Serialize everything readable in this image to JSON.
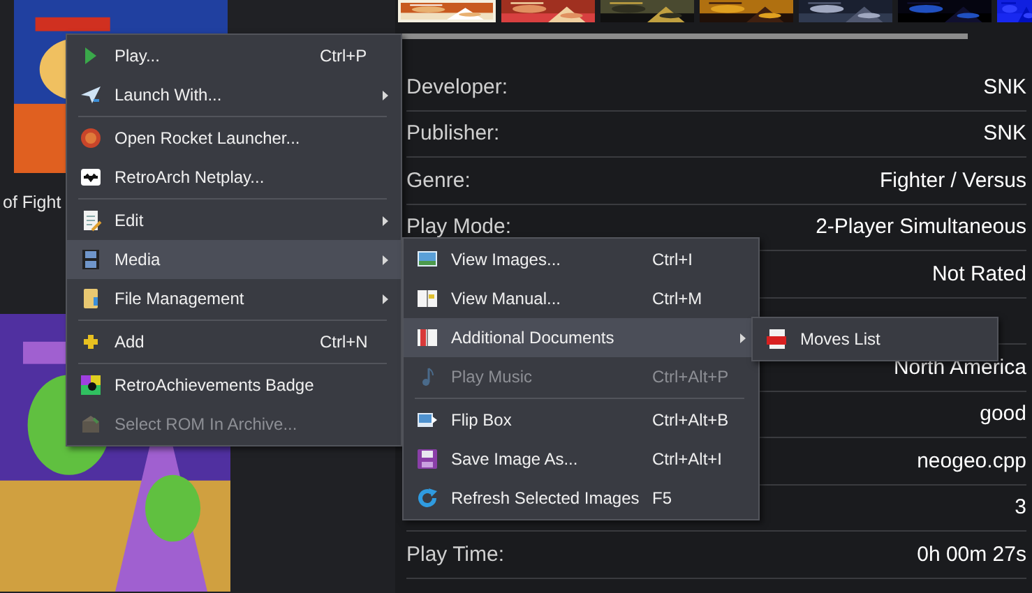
{
  "library": {
    "caption": "of Fight"
  },
  "details": {
    "rows": [
      {
        "label": "Developer:",
        "value": "SNK"
      },
      {
        "label": "Publisher:",
        "value": "SNK"
      },
      {
        "label": "Genre:",
        "value": "Fighter / Versus"
      },
      {
        "label": "Play Mode:",
        "value": "2-Player Simultaneous"
      },
      {
        "value": "Not Rated"
      },
      {},
      {
        "value": "North America"
      },
      {
        "value": "good"
      },
      {
        "value": "neogeo.cpp"
      },
      {
        "value": "3"
      },
      {
        "label": "Play Time:",
        "value": "0h 00m 27s"
      }
    ]
  },
  "context_menu": {
    "items": [
      {
        "kind": "item",
        "label": "Play...",
        "shortcut": "Ctrl+P",
        "has_submenu": false,
        "disabled": false,
        "selected": false
      },
      {
        "kind": "item",
        "label": "Launch With...",
        "has_submenu": true,
        "disabled": false,
        "selected": false
      },
      {
        "kind": "separator"
      },
      {
        "kind": "item",
        "label": "Open Rocket Launcher...",
        "has_submenu": false,
        "disabled": false,
        "selected": false
      },
      {
        "kind": "item",
        "label": "RetroArch Netplay...",
        "has_submenu": false,
        "disabled": false,
        "selected": false
      },
      {
        "kind": "separator"
      },
      {
        "kind": "item",
        "label": "Edit",
        "has_submenu": true,
        "disabled": false,
        "selected": false
      },
      {
        "kind": "item",
        "label": "Media",
        "has_submenu": true,
        "disabled": false,
        "selected": true
      },
      {
        "kind": "item",
        "label": "File Management",
        "has_submenu": true,
        "disabled": false,
        "selected": false
      },
      {
        "kind": "separator"
      },
      {
        "kind": "item",
        "label": "Add",
        "shortcut": "Ctrl+N",
        "has_submenu": false,
        "disabled": false,
        "selected": false
      },
      {
        "kind": "separator"
      },
      {
        "kind": "item",
        "label": "RetroAchievements Badge",
        "has_submenu": false,
        "disabled": false,
        "selected": false
      },
      {
        "kind": "item",
        "label": "Select ROM In Archive...",
        "has_submenu": false,
        "disabled": true,
        "selected": false
      }
    ]
  },
  "media_menu": {
    "items": [
      {
        "kind": "item",
        "label": "View Images...",
        "shortcut": "Ctrl+I",
        "has_submenu": false,
        "disabled": false,
        "selected": false
      },
      {
        "kind": "item",
        "label": "View Manual...",
        "shortcut": "Ctrl+M",
        "has_submenu": false,
        "disabled": false,
        "selected": false
      },
      {
        "kind": "item",
        "label": "Additional Documents",
        "has_submenu": true,
        "disabled": false,
        "selected": true
      },
      {
        "kind": "item",
        "label": "Play Music",
        "shortcut": "Ctrl+Alt+P",
        "has_submenu": false,
        "disabled": true,
        "selected": false
      },
      {
        "kind": "separator"
      },
      {
        "kind": "item",
        "label": "Flip Box",
        "shortcut": "Ctrl+Alt+B",
        "has_submenu": false,
        "disabled": false,
        "selected": false
      },
      {
        "kind": "item",
        "label": "Save Image As...",
        "shortcut": "Ctrl+Alt+I",
        "has_submenu": false,
        "disabled": false,
        "selected": false
      },
      {
        "kind": "item",
        "label": "Refresh Selected Images",
        "shortcut": "F5",
        "has_submenu": false,
        "disabled": false,
        "selected": false
      }
    ]
  },
  "documents_menu": {
    "items": [
      {
        "kind": "item",
        "label": "Moves List",
        "has_submenu": false,
        "disabled": false,
        "selected": false
      }
    ]
  }
}
